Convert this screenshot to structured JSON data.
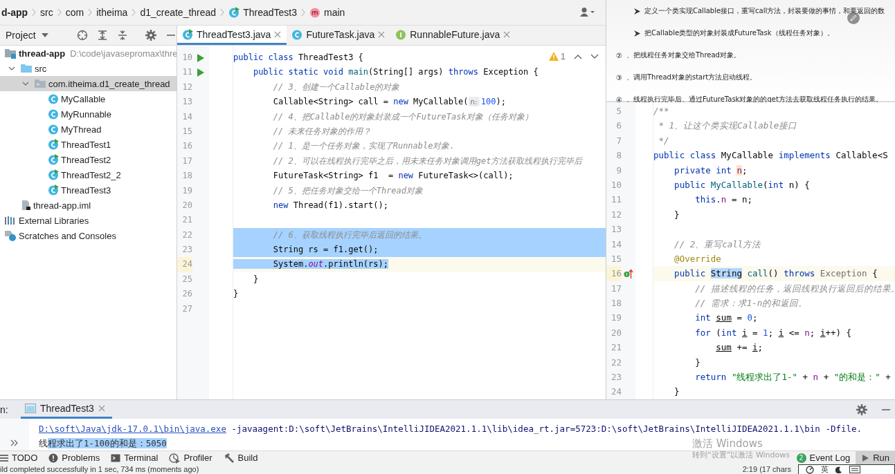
{
  "breadcrumbs": [
    {
      "label": "d-app",
      "kind": "module"
    },
    {
      "label": "src",
      "kind": "plain"
    },
    {
      "label": "com",
      "kind": "plain"
    },
    {
      "label": "itheima",
      "kind": "plain"
    },
    {
      "label": "d1_create_thread",
      "kind": "plain"
    },
    {
      "label": "ThreadTest3",
      "kind": "class"
    },
    {
      "label": "main",
      "kind": "method"
    }
  ],
  "project": {
    "title": "Project",
    "tree": [
      {
        "label": "thread-app",
        "kind": "module",
        "detail": "D:\\code\\javasepromax\\thre",
        "selected": false,
        "children": [
          {
            "label": "src",
            "kind": "folder",
            "expanded": true,
            "selected": false,
            "children": [
              {
                "label": "com.itheima.d1_create_thread",
                "kind": "package",
                "expanded": true,
                "selected": true,
                "children": [
                  {
                    "label": "MyCallable",
                    "kind": "class",
                    "selected": false
                  },
                  {
                    "label": "MyRunnable",
                    "kind": "class",
                    "selected": false
                  },
                  {
                    "label": "MyThread",
                    "kind": "class",
                    "selected": false
                  },
                  {
                    "label": "ThreadTest1",
                    "kind": "class-run",
                    "selected": false
                  },
                  {
                    "label": "ThreadTest2",
                    "kind": "class-run",
                    "selected": false
                  },
                  {
                    "label": "ThreadTest2_2",
                    "kind": "class-run",
                    "selected": false
                  },
                  {
                    "label": "ThreadTest3",
                    "kind": "class-run",
                    "selected": false
                  }
                ]
              }
            ]
          },
          {
            "label": "thread-app.iml",
            "kind": "file",
            "selected": false
          }
        ]
      },
      {
        "label": "External Libraries",
        "kind": "libraries",
        "selected": false
      },
      {
        "label": "Scratches and Consoles",
        "kind": "scratches",
        "selected": false
      }
    ]
  },
  "editor_tabs": [
    {
      "label": "ThreadTest3.java",
      "kind": "class-run",
      "selected": true
    },
    {
      "label": "FutureTask.java",
      "kind": "class",
      "selected": false
    },
    {
      "label": "RunnableFuture.java",
      "kind": "interface",
      "selected": false
    }
  ],
  "editor": {
    "warnings": "1",
    "lines": [
      {
        "number": "10",
        "kind": "run",
        "selected": false,
        "current": false,
        "tokens": [
          {
            "kind": "keyword",
            "text": "public class "
          },
          {
            "kind": "plain",
            "text": "ThreadTest3 {"
          }
        ]
      },
      {
        "number": "11",
        "kind": "run",
        "selected": false,
        "current": false,
        "tokens": [
          {
            "kind": "keyword",
            "text": "    public static void "
          },
          {
            "kind": "method",
            "text": "main"
          },
          {
            "kind": "plain",
            "text": "(String[] args) "
          },
          {
            "kind": "keyword",
            "text": "throws "
          },
          {
            "kind": "plain",
            "text": "Exception {"
          }
        ]
      },
      {
        "number": "12",
        "kind": "code",
        "selected": false,
        "current": false,
        "tokens": [
          {
            "kind": "comment",
            "text": "        // 3、创建一个Callable的对象"
          }
        ]
      },
      {
        "number": "13",
        "kind": "code",
        "selected": false,
        "current": false,
        "tokens": [
          {
            "kind": "plain",
            "text": "        Callable<String> call = "
          },
          {
            "kind": "keyword",
            "text": "new "
          },
          {
            "kind": "plain",
            "text": "MyCallable("
          },
          {
            "kind": "hint",
            "text": "n:"
          },
          {
            "kind": "number",
            "text": "100"
          },
          {
            "kind": "plain",
            "text": ");"
          }
        ]
      },
      {
        "number": "14",
        "kind": "code",
        "selected": false,
        "current": false,
        "tokens": [
          {
            "kind": "comment",
            "text": "        // 4、把Callable的对象封装成一个FutureTask对象（任务对象）"
          }
        ]
      },
      {
        "number": "15",
        "kind": "code",
        "selected": false,
        "current": false,
        "tokens": [
          {
            "kind": "comment",
            "text": "        // 未来任务对象的作用？"
          }
        ]
      },
      {
        "number": "16",
        "kind": "code",
        "selected": false,
        "current": false,
        "tokens": [
          {
            "kind": "comment",
            "text": "        // 1、是一个任务对象，实现了Runnable对象."
          }
        ]
      },
      {
        "number": "17",
        "kind": "code",
        "selected": false,
        "current": false,
        "tokens": [
          {
            "kind": "comment",
            "text": "        // 2、可以在线程执行完毕之后，用未来任务对象调用get方法获取线程执行完毕后"
          }
        ]
      },
      {
        "number": "18",
        "kind": "code",
        "selected": false,
        "current": false,
        "tokens": [
          {
            "kind": "plain",
            "text": "        FutureTask<String> f1  = "
          },
          {
            "kind": "keyword",
            "text": "new "
          },
          {
            "kind": "plain",
            "text": "FutureTask<>(call);"
          }
        ]
      },
      {
        "number": "19",
        "kind": "code",
        "selected": false,
        "current": false,
        "tokens": [
          {
            "kind": "comment",
            "text": "        // 5、把任务对象交给一个Thread对象"
          }
        ]
      },
      {
        "number": "20",
        "kind": "code",
        "selected": false,
        "current": false,
        "tokens": [
          {
            "kind": "keyword",
            "text": "        new "
          },
          {
            "kind": "plain",
            "text": "Thread(f1).start();"
          }
        ]
      },
      {
        "number": "21",
        "kind": "code",
        "selected": false,
        "current": false
      },
      {
        "number": "22",
        "kind": "code",
        "selected": true,
        "current": false,
        "tokens": [
          {
            "kind": "comment",
            "text": "        // 6、获取线程执行完毕后返回的结果。"
          }
        ]
      },
      {
        "number": "23",
        "kind": "code",
        "selected": true,
        "current": false,
        "tokens": [
          {
            "kind": "plain",
            "text": "        String rs = f1.get();"
          }
        ]
      },
      {
        "number": "24",
        "kind": "code",
        "selected": true,
        "current": true,
        "tokens": [
          {
            "kind": "plain",
            "text": "        System."
          },
          {
            "kind": "static",
            "text": "out"
          },
          {
            "kind": "plain",
            "text": ".println(rs);"
          }
        ]
      },
      {
        "number": "25",
        "kind": "code",
        "selected": false,
        "current": false,
        "tokens": [
          {
            "kind": "plain",
            "text": "    }"
          }
        ]
      },
      {
        "number": "26",
        "kind": "code",
        "selected": false,
        "current": false,
        "tokens": [
          {
            "kind": "plain",
            "text": "}"
          }
        ]
      },
      {
        "number": "27",
        "kind": "code",
        "selected": false,
        "current": false
      }
    ]
  },
  "slide": {
    "items": [
      {
        "kind": "arrow",
        "text": "定义一个类实现Callable接口，重写call方法，封装要做的事情，和要返回的数"
      },
      {
        "kind": "arrow",
        "text": "把Callable类型的对象封装成FutureTask（线程任务对象）。"
      },
      {
        "kind": "circled",
        "marker": "②",
        "text": "、把线程任务对象交给Thread对象。"
      },
      {
        "kind": "circled",
        "marker": "③",
        "text": "、调用Thread对象的start方法启动线程。"
      },
      {
        "kind": "circled",
        "marker": "④",
        "text": "、线程执行完毕后、通过FutureTask对象的的get方法去获取线程任务执行的结果。"
      }
    ]
  },
  "side_editor": {
    "lines": [
      {
        "number": "5",
        "kind": "code",
        "selected": false,
        "current": false,
        "tokens": [
          {
            "kind": "comment",
            "text": "/**"
          }
        ]
      },
      {
        "number": "6",
        "kind": "code",
        "selected": false,
        "current": false,
        "tokens": [
          {
            "kind": "comment",
            "text": " * 1、让这个类实现Callable接口"
          }
        ]
      },
      {
        "number": "7",
        "kind": "code",
        "selected": false,
        "current": false,
        "tokens": [
          {
            "kind": "comment",
            "text": " */"
          }
        ]
      },
      {
        "number": "8",
        "kind": "code",
        "selected": false,
        "current": false,
        "tokens": [
          {
            "kind": "keyword",
            "text": "public class "
          },
          {
            "kind": "plain",
            "text": "MyCallable "
          },
          {
            "kind": "keyword",
            "text": "implements "
          },
          {
            "kind": "plain",
            "text": "Callable<S"
          }
        ]
      },
      {
        "number": "9",
        "kind": "code",
        "selected": false,
        "current": false,
        "tokens": [
          {
            "kind": "keyword",
            "text": "    private int "
          },
          {
            "kind": "marked-field",
            "text": "n"
          },
          {
            "kind": "plain",
            "text": ";"
          }
        ]
      },
      {
        "number": "10",
        "kind": "code",
        "selected": false,
        "current": false,
        "tokens": [
          {
            "kind": "keyword",
            "text": "    public "
          },
          {
            "kind": "method",
            "text": "MyCallable"
          },
          {
            "kind": "plain",
            "text": "("
          },
          {
            "kind": "keyword",
            "text": "int "
          },
          {
            "kind": "plain",
            "text": "n) {"
          }
        ]
      },
      {
        "number": "11",
        "kind": "code",
        "selected": false,
        "current": false,
        "tokens": [
          {
            "kind": "keyword",
            "text": "        this"
          },
          {
            "kind": "plain",
            "text": "."
          },
          {
            "kind": "field",
            "text": "n"
          },
          {
            "kind": "plain",
            "text": " = n;"
          }
        ]
      },
      {
        "number": "12",
        "kind": "code",
        "selected": false,
        "current": false,
        "tokens": [
          {
            "kind": "plain",
            "text": "    }"
          }
        ]
      },
      {
        "number": "13",
        "kind": "code",
        "selected": false,
        "current": false
      },
      {
        "number": "14",
        "kind": "code",
        "selected": false,
        "current": false,
        "tokens": [
          {
            "kind": "comment",
            "text": "    // 2、重写call方法"
          }
        ]
      },
      {
        "number": "15",
        "kind": "code",
        "selected": false,
        "current": false,
        "tokens": [
          {
            "kind": "annotation",
            "text": "    @Override"
          }
        ]
      },
      {
        "number": "16",
        "kind": "override",
        "selected": false,
        "current": true,
        "tokens": [
          {
            "kind": "keyword",
            "text": "    public "
          },
          {
            "kind": "match",
            "text": "String"
          },
          {
            "kind": "method",
            "text": " call"
          },
          {
            "kind": "plain",
            "text": "() "
          },
          {
            "kind": "keyword",
            "text": "throws "
          },
          {
            "kind": "dim",
            "text": "Exception"
          },
          {
            "kind": "plain",
            "text": " {"
          }
        ]
      },
      {
        "number": "17",
        "kind": "code",
        "selected": false,
        "current": false,
        "tokens": [
          {
            "kind": "comment",
            "text": "        // 描述线程的任务，返回线程执行返回后的结果。"
          }
        ]
      },
      {
        "number": "18",
        "kind": "code",
        "selected": false,
        "current": false,
        "tokens": [
          {
            "kind": "comment",
            "text": "        // 需求：求1-n的和返回。"
          }
        ]
      },
      {
        "number": "19",
        "kind": "code",
        "selected": false,
        "current": false,
        "tokens": [
          {
            "kind": "keyword",
            "text": "        int "
          },
          {
            "kind": "variable",
            "text": "sum"
          },
          {
            "kind": "plain",
            "text": " = "
          },
          {
            "kind": "number",
            "text": "0"
          },
          {
            "kind": "plain",
            "text": ";"
          }
        ]
      },
      {
        "number": "20",
        "kind": "code",
        "selected": false,
        "current": false,
        "tokens": [
          {
            "kind": "keyword",
            "text": "        for "
          },
          {
            "kind": "plain",
            "text": "("
          },
          {
            "kind": "keyword",
            "text": "int "
          },
          {
            "kind": "variable",
            "text": "i"
          },
          {
            "kind": "plain",
            "text": " = "
          },
          {
            "kind": "number",
            "text": "1"
          },
          {
            "kind": "plain",
            "text": "; "
          },
          {
            "kind": "variable",
            "text": "i"
          },
          {
            "kind": "plain",
            "text": " <= "
          },
          {
            "kind": "field",
            "text": "n"
          },
          {
            "kind": "plain",
            "text": "; "
          },
          {
            "kind": "variable",
            "text": "i"
          },
          {
            "kind": "plain",
            "text": "++) {"
          }
        ]
      },
      {
        "number": "21",
        "kind": "code",
        "selected": false,
        "current": false,
        "tokens": [
          {
            "kind": "variable",
            "text": "            sum"
          },
          {
            "kind": "plain",
            "text": " += "
          },
          {
            "kind": "variable",
            "text": "i"
          },
          {
            "kind": "plain",
            "text": ";"
          }
        ]
      },
      {
        "number": "22",
        "kind": "code",
        "selected": false,
        "current": false,
        "tokens": [
          {
            "kind": "plain",
            "text": "        }"
          }
        ]
      },
      {
        "number": "23",
        "kind": "code",
        "selected": false,
        "current": false,
        "tokens": [
          {
            "kind": "keyword",
            "text": "        return "
          },
          {
            "kind": "string",
            "text": "\"线程求出了1-\""
          },
          {
            "kind": "plain",
            "text": " + "
          },
          {
            "kind": "field",
            "text": "n"
          },
          {
            "kind": "plain",
            "text": " + "
          },
          {
            "kind": "string",
            "text": "\"的和是：\""
          },
          {
            "kind": "plain",
            "text": " +"
          }
        ]
      },
      {
        "number": "24",
        "kind": "code",
        "selected": false,
        "current": false,
        "tokens": [
          {
            "kind": "plain",
            "text": "    }"
          }
        ]
      }
    ]
  },
  "run": {
    "label": "n:",
    "tabs": [
      {
        "label": "ThreadTest3",
        "selected": true
      }
    ],
    "console": [
      {
        "tokens": [
          {
            "kind": "link",
            "text": "D:\\soft\\Java\\jdk-17.0.1\\bin\\java.exe"
          },
          {
            "kind": "command",
            "text": " -javaagent:D:\\soft\\JetBrains\\IntelliJIDEA2021.1.1\\lib\\idea_rt.jar=5723:D:\\soft\\JetBrains\\IntelliJIDEA2021.1.1\\bin -Dfile."
          }
        ]
      },
      {
        "tokens": [
          {
            "kind": "output",
            "text": "线"
          },
          {
            "kind": "selected",
            "text": "程求出了1-100的和是：5050"
          }
        ]
      }
    ]
  },
  "tool_tabs": {
    "left": [
      {
        "label": "TODO",
        "kind": "todo",
        "selected": false
      },
      {
        "label": "Problems",
        "kind": "problems",
        "selected": false
      },
      {
        "label": "Terminal",
        "kind": "terminal",
        "selected": false
      },
      {
        "label": "Profiler",
        "kind": "profiler",
        "selected": false
      },
      {
        "label": "Build",
        "kind": "build",
        "selected": false
      }
    ],
    "right": [
      {
        "label": "Event Log",
        "kind": "event-log",
        "badge": "2",
        "selected": false
      },
      {
        "label": "Run",
        "kind": "run",
        "selected": true
      }
    ]
  },
  "status": {
    "message": "ild completed successfully in 1 sec, 734 ms (moments ago)",
    "position": "2:19 (17 chars",
    "ime": "英"
  },
  "os_notice": {
    "title": "激活 Windows",
    "text": "转到“设置”以激活 Windows"
  }
}
